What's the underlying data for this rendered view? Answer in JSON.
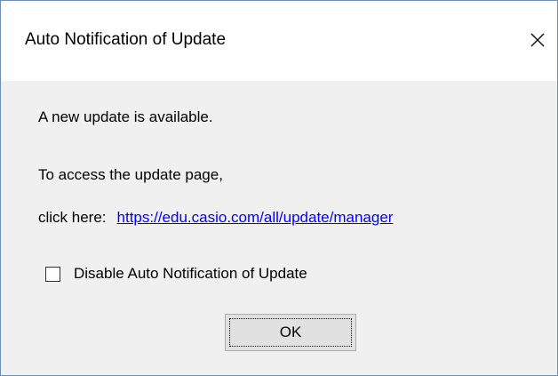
{
  "window": {
    "title": "Auto Notification of Update",
    "close_icon": "close-icon"
  },
  "message": {
    "line1": "A new update is available.",
    "line2": "To access the update page,",
    "line3_prefix": "click here:",
    "link_text": "https://edu.casio.com/all/update/manager"
  },
  "checkbox": {
    "label": "Disable Auto Notification of Update",
    "checked": false
  },
  "buttons": {
    "ok_label": "OK"
  },
  "colors": {
    "link": "#0000ff",
    "window_border": "#6e8fb5",
    "content_bg": "#f0f0f0"
  }
}
